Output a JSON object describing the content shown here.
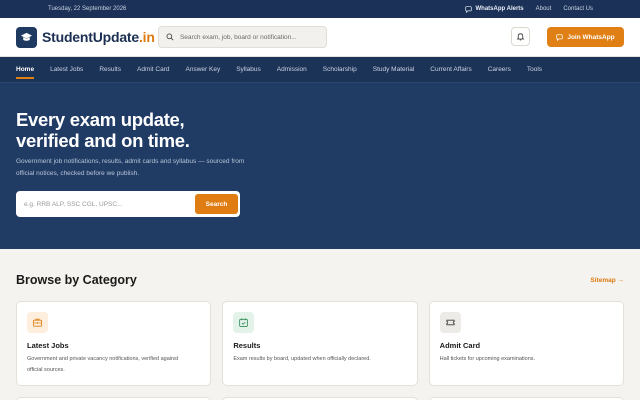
{
  "topbar": {
    "date": "Tuesday, 22 September 2026",
    "whatsapp": "WhatsApp Alerts",
    "about": "About",
    "contact": "Contact Us"
  },
  "header": {
    "logo_main": "StudentUpdate",
    "logo_accent": ".in",
    "search_placeholder": "Search exam, job, board or notification...",
    "join_label": "Join WhatsApp"
  },
  "nav": {
    "items": [
      "Home",
      "Latest Jobs",
      "Results",
      "Admit Card",
      "Answer Key",
      "Syllabus",
      "Admission",
      "Scholarship",
      "Study Material",
      "Current Affairs",
      "Careers",
      "Tools"
    ]
  },
  "hero": {
    "title_line1": "Every exam update,",
    "title_line2": "verified and on time.",
    "subtitle_line1": "Government job notifications, results, admit cards and syllabus — sourced from",
    "subtitle_line2": "official notices, checked before we publish.",
    "search_placeholder": "e.g. RRB ALP, SSC CGL, UPSC...",
    "search_button": "Search"
  },
  "browse": {
    "title": "Browse by Category",
    "sitemap": "Sitemap →",
    "cards": [
      {
        "title": "Latest Jobs",
        "desc_line1": "Government and private vacancy notifications, verified against",
        "desc_line2": "official sources.",
        "icon": "briefcase-icon",
        "bg": "#fdeedd",
        "color": "#df7d12"
      },
      {
        "title": "Results",
        "desc_line1": "Exam results by board, updated when officially declared.",
        "desc_line2": "",
        "icon": "calendar-check-icon",
        "bg": "#e4f3ea",
        "color": "#2f8a55"
      },
      {
        "title": "Admit Card",
        "desc_line1": "Hall tickets for upcoming examinations.",
        "desc_line2": "",
        "icon": "ticket-icon",
        "bg": "#ecebe8",
        "color": "#3d3d3d"
      }
    ]
  },
  "colors": {
    "navy": "#1c3358",
    "accent": "#e07f13",
    "background": "#f5f3ef"
  }
}
